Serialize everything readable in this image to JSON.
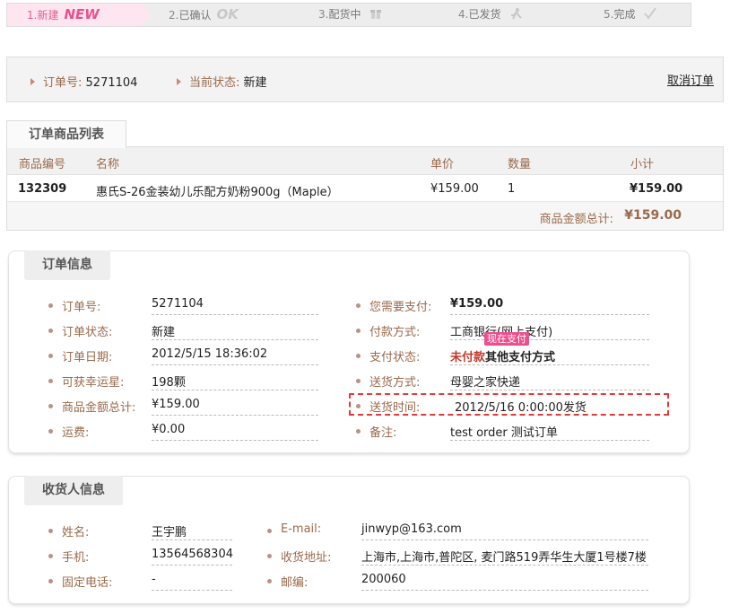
{
  "steps": [
    {
      "num": "1.",
      "label": "新建",
      "badge": "NEW"
    },
    {
      "num": "2.",
      "label": "已确认",
      "badge": "OK"
    },
    {
      "num": "3.",
      "label": "配货中"
    },
    {
      "num": "4.",
      "label": "已发货"
    },
    {
      "num": "5.",
      "label": "完成"
    }
  ],
  "order_head": {
    "order_no_label": "订单号:",
    "order_no": "5271104",
    "status_label": "当前状态:",
    "status": "新建",
    "cancel_link": "取消订单"
  },
  "goods": {
    "tab": "订单商品列表",
    "columns": [
      "商品编号",
      "名称",
      "单价",
      "数量",
      "小计"
    ],
    "rows": [
      {
        "sku": "132309",
        "name": "惠氏S-26金装幼儿乐配方奶粉900g（Maple）",
        "price": "¥159.00",
        "qty": "1",
        "subtotal": "¥159.00"
      }
    ],
    "total_label": "商品金额总计:",
    "total": "¥159.00"
  },
  "order_info": {
    "title": "订单信息",
    "left": [
      {
        "label": "订单号:",
        "value": "5271104"
      },
      {
        "label": "订单状态:",
        "value": "新建"
      },
      {
        "label": "订单日期:",
        "value": "2012/5/15 18:36:02"
      },
      {
        "label": "可获幸运星:",
        "value": "198颗"
      },
      {
        "label": "商品金额总计:",
        "value": "¥159.00"
      },
      {
        "label": "运费:",
        "value": "¥0.00"
      }
    ],
    "right": [
      {
        "label": "您需要支付:",
        "value": "¥159.00"
      },
      {
        "label": "付款方式:",
        "value": "工商银行(网上支付)"
      },
      {
        "label": "支付状态:",
        "value_unpaid": "未付款",
        "value_other": "其他支付方式"
      },
      {
        "label": "送货方式:",
        "value": "母婴之家快递"
      },
      {
        "label": "送货时间:",
        "value": "2012/5/16 0:00:00发货"
      },
      {
        "label": "备注:",
        "value": "test order 测试订单"
      }
    ],
    "pay_now_tip": "现在支付"
  },
  "consignee": {
    "title": "收货人信息",
    "left": [
      {
        "label": "姓名:",
        "value": "王宇鹏"
      },
      {
        "label": "手机:",
        "value": "13564568304"
      },
      {
        "label": "固定电话:",
        "value": "-"
      }
    ],
    "right": [
      {
        "label": "E-mail:",
        "value": "jinwyp@163.com"
      },
      {
        "label": "收货地址:",
        "value": "上海市,上海市,普陀区,឴ 麦门路519弄华生大厦1号楼7楼"
      },
      {
        "label": "邮编:",
        "value": "200060"
      }
    ]
  },
  "colors": {
    "accent": "#ec4f8d",
    "label": "#9a6a4c",
    "alert": "#c0392b"
  }
}
